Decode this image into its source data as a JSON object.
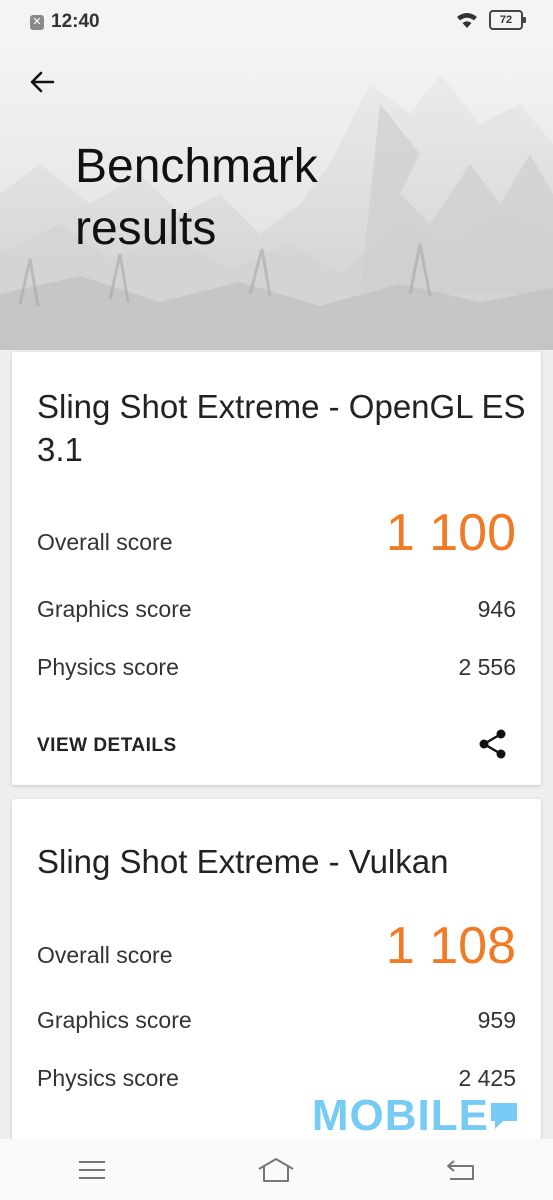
{
  "status_bar": {
    "time": "12:40",
    "battery": "72",
    "notification_icon": "app-notification-icon",
    "wifi_icon": "wifi-icon"
  },
  "header": {
    "back_icon": "arrow-left-icon",
    "title": "Benchmark results"
  },
  "results": [
    {
      "title": "Sling Shot Extreme - OpenGL ES 3.1",
      "overall_label": "Overall score",
      "overall_value": "1 100",
      "graphics_label": "Graphics score",
      "graphics_value": "946",
      "physics_label": "Physics score",
      "physics_value": "2 556",
      "details_label": "VIEW DETAILS",
      "share_icon": "share-icon"
    },
    {
      "title": "Sling Shot Extreme - Vulkan",
      "overall_label": "Overall score",
      "overall_value": "1 108",
      "graphics_label": "Graphics score",
      "graphics_value": "959",
      "physics_label": "Physics score",
      "physics_value": "2 425"
    }
  ],
  "watermark": "MOBILE",
  "colors": {
    "score_accent": "#f07b24",
    "watermark": "#5ec3f2"
  },
  "nav_bar": {
    "menu_icon": "menu-icon",
    "home_icon": "home-icon",
    "back_icon": "back-return-icon"
  }
}
